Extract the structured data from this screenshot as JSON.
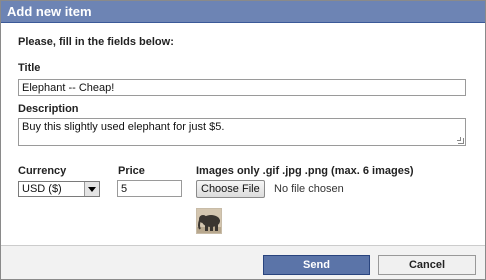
{
  "dialog": {
    "title": "Add new item",
    "intro": "Please, fill in the fields below:"
  },
  "form": {
    "title_label": "Title",
    "title_value": "Elephant -- Cheap!",
    "description_label": "Description",
    "description_value": "Buy this slightly used elephant for just $5.",
    "currency_label": "Currency",
    "currency_value": "USD ($)",
    "price_label": "Price",
    "price_value": "5",
    "images_label": "Images only .gif .jpg .png (max. 6 images)",
    "choose_file_label": "Choose File",
    "file_status": "No file chosen",
    "thumbnail_icon": "elephant-thumbnail-icon"
  },
  "footer": {
    "send_label": "Send",
    "cancel_label": "Cancel"
  },
  "colors": {
    "title_bar": "#6d84b4",
    "send_button": "#5b74a8"
  }
}
